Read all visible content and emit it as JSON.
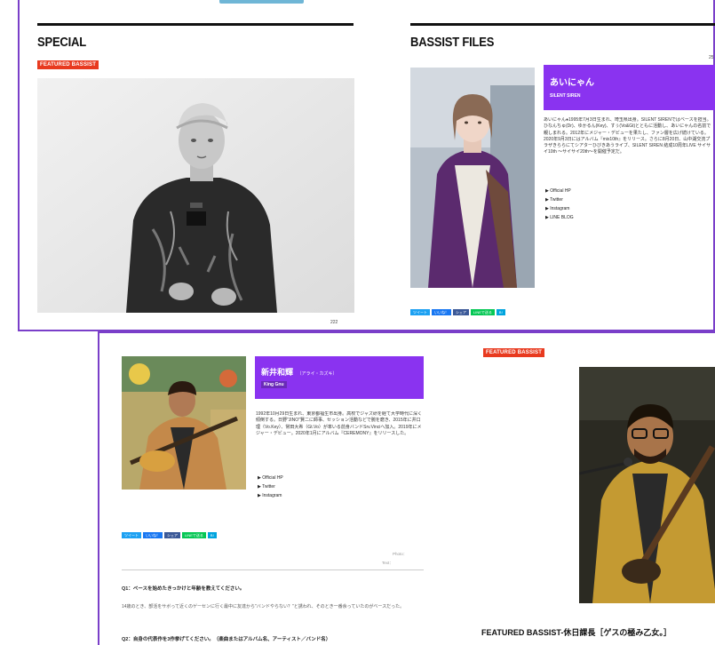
{
  "special": {
    "title": "SPECIAL",
    "badge": "FEATURED BASSIST",
    "counter": "222"
  },
  "bassist_files": {
    "title": "BASSIST FILES",
    "counter": "25",
    "profile": {
      "name": "あいにゃん",
      "band": "SILENT SIREN",
      "bio": "あいにゃん●1995年7月3日生まれ、埼玉県出身。SILENT SIRENではベースを担当。ひなんちゅ(Dr)、ゆかるん(Key)、すぅ(Vo&Gt)とともに活動し、あいにゃんの名前で親しまれる。2012年にメジャー・デビューを果たし、ファン層を広げ続けている。2020年9月3日にはアルバム『mix10th』をリリース。さらに8月20日、山中湖交流プラザきららにてシアターひびきあうライブ、SILENT SIREN 結成10周年LIVE サイサイ10th 〜サイサイ20th〜を開催予定だ。",
      "links": [
        "Official HP",
        "Twitter",
        "Instagram",
        "LINE BLOG"
      ]
    }
  },
  "share_buttons": [
    "ツイート",
    "いいね！",
    "シェア",
    "LINEで送る",
    "B!"
  ],
  "bassist2": {
    "name": "新井和輝",
    "reading": "（アライ・カズキ）",
    "band": "King Gnu",
    "bio": "1992年10月29日生まれ、東京都福生市出身。高校でジャズ研を経て大学時代に深く傾倒する。日野\"JINO\"賢二に師事、セッション活動などで腕を磨き、2015年に井口理（Vo.Key）、常田大希（Gt.Vo）が率いる前身バンドSrv.Vinciへ加入。2019年にメジャー・デビュー。2020年1月にアルバム『CEREMONY』をリリースした。",
    "links": [
      "Official HP",
      "Twitter",
      "Instagram"
    ],
    "meta_line1": "Photo：",
    "meta_line2": "Text：",
    "q1": "Q1：ベースを始めたきっかけと年齢を教えてください。",
    "a1": "14歳のとき、部活をサボって近くのゲーセンに行く最中に友達から\"バンドやらない？\"と誘われ、そのとき一番余っていたのがベースだった。",
    "q2": "Q2：自身の代表作を3作挙げてください。（楽曲またはアルバム名、アーティスト／バンド名）"
  },
  "featured": {
    "badge": "FEATURED BASSIST",
    "title": "FEATURED BASSIST-休日課長［ゲスの極み乙女。］"
  },
  "colors": {
    "accent_purple": "#8a33f0",
    "badge_red": "#e83a1f",
    "frame_purple": "#7a3fc9",
    "twitter": "#1da1f2",
    "facebook": "#1877f2",
    "line": "#06c755",
    "hatena": "#00a4de"
  }
}
